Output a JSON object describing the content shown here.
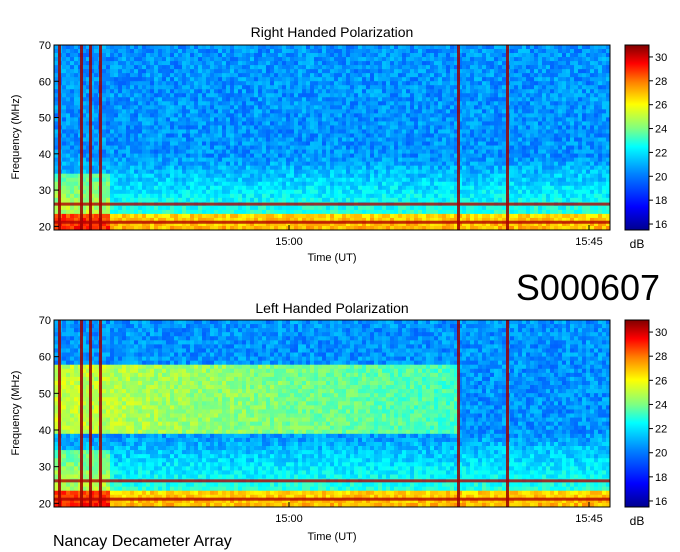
{
  "header": {
    "id_label": "S000607"
  },
  "footer": {
    "instrument": "Nancay Decameter Array"
  },
  "colors": {
    "cmap": [
      "#00008f",
      "#0000ff",
      "#0080ff",
      "#00ffff",
      "#80ff80",
      "#ffff00",
      "#ff8000",
      "#ff0000",
      "#800000"
    ]
  },
  "chart_data": [
    {
      "type": "heatmap",
      "title": "Right Handed Polarization",
      "xlabel": "Time (UT)",
      "ylabel": "Frequency (MHz)",
      "x_ticks": [
        "15:00",
        "15:45"
      ],
      "y_ticks": [
        20,
        30,
        40,
        50,
        60,
        70
      ],
      "ylim": [
        19,
        70
      ],
      "colorbar": {
        "label": "dB",
        "ticks": [
          16,
          18,
          20,
          22,
          24,
          26,
          28,
          30
        ],
        "range": [
          15.5,
          31
        ]
      }
    },
    {
      "type": "heatmap",
      "title": "Left Handed Polarization",
      "xlabel": "Time (UT)",
      "ylabel": "Frequency (MHz)",
      "x_ticks": [
        "15:00",
        "15:45"
      ],
      "y_ticks": [
        20,
        30,
        40,
        50,
        60,
        70
      ],
      "ylim": [
        19,
        70
      ],
      "colorbar": {
        "label": "dB",
        "ticks": [
          16,
          18,
          20,
          22,
          24,
          26,
          28,
          30
        ],
        "range": [
          15.5,
          31
        ]
      }
    }
  ]
}
